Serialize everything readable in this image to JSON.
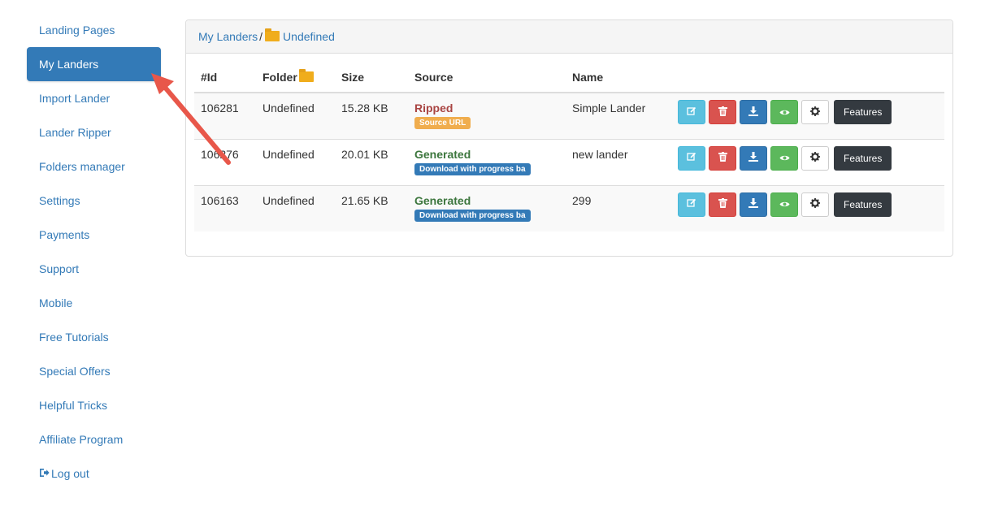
{
  "sidebar": {
    "items": [
      {
        "label": "Landing Pages"
      },
      {
        "label": "My Landers",
        "active": true
      },
      {
        "label": "Import Lander"
      },
      {
        "label": "Lander Ripper"
      },
      {
        "label": "Folders manager"
      },
      {
        "label": "Settings"
      },
      {
        "label": "Payments"
      },
      {
        "label": "Support"
      },
      {
        "label": "Mobile"
      },
      {
        "label": "Free Tutorials"
      },
      {
        "label": "Special Offers"
      },
      {
        "label": "Helpful Tricks"
      },
      {
        "label": "Affiliate Program"
      },
      {
        "label": "Log out",
        "icon": "logout-icon"
      }
    ]
  },
  "breadcrumb": {
    "root": "My Landers",
    "separator": "/",
    "folder_icon": "folder-icon",
    "current": "Undefined"
  },
  "table": {
    "headers": {
      "id": "#Id",
      "folder": "Folder",
      "size": "Size",
      "source": "Source",
      "name": "Name"
    },
    "rows": [
      {
        "id": "106281",
        "folder": "Undefined",
        "size": "15.28 KB",
        "source": "Ripped",
        "source_badge": "Source URL",
        "name": "Simple Lander",
        "features": "Features"
      },
      {
        "id": "106276",
        "folder": "Undefined",
        "size": "20.01 KB",
        "source": "Generated",
        "source_badge": "Download with progress ba",
        "name": "new lander",
        "features": "Features"
      },
      {
        "id": "106163",
        "folder": "Undefined",
        "size": "21.65 KB",
        "source": "Generated",
        "source_badge": "Download with progress ba",
        "name": "299",
        "features": "Features"
      }
    ]
  },
  "action_icons": [
    "edit-icon",
    "trash-icon",
    "download-icon",
    "eye-icon",
    "gear-icon"
  ],
  "colors": {
    "accent": "#337ab7",
    "ripped": "#a94442",
    "generated": "#3c763d",
    "warning": "#f0ad4e",
    "danger": "#d9534f",
    "success": "#5cb85c",
    "info": "#5bc0de",
    "arrow": "#e8574a"
  }
}
